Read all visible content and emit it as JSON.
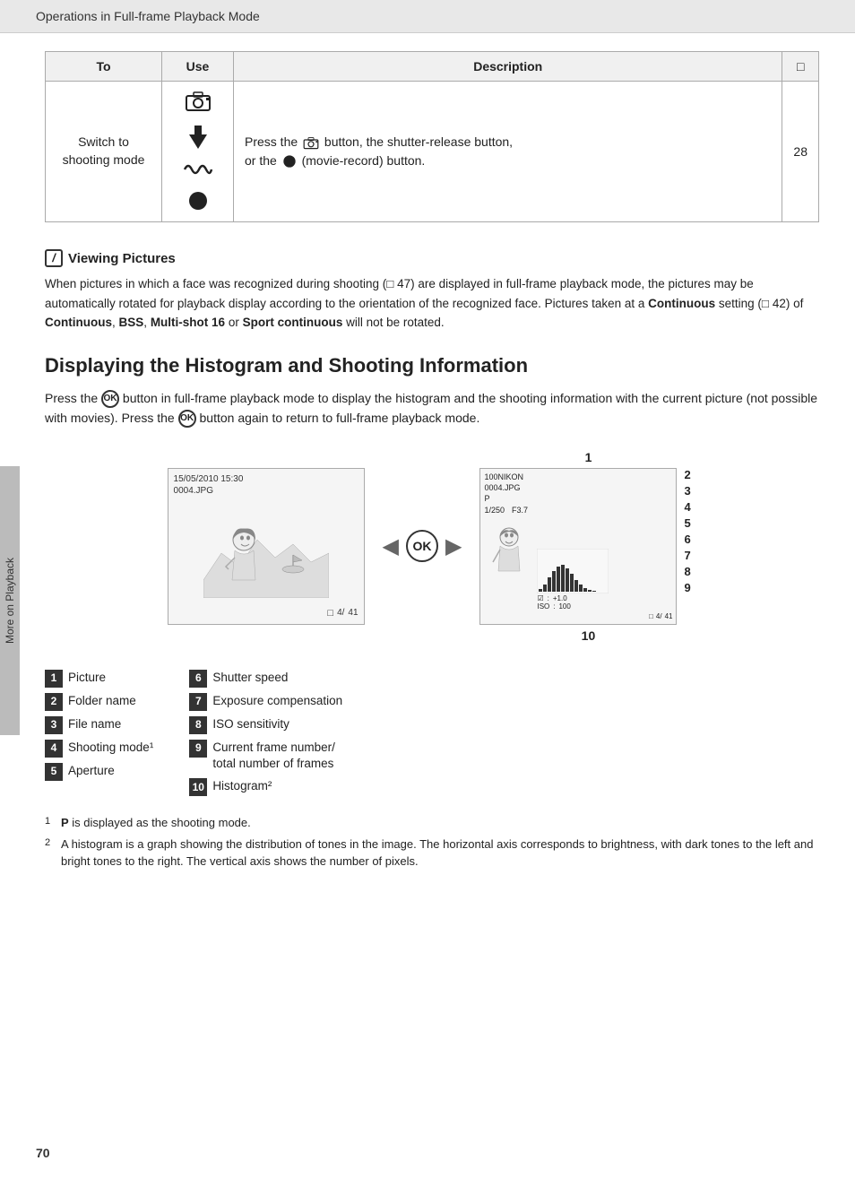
{
  "header": {
    "title": "Operations in Full-frame Playback Mode"
  },
  "table": {
    "headers": [
      "To",
      "Use",
      "Description",
      "□"
    ],
    "row": {
      "to_line1": "Switch to",
      "to_line2": "shooting mode",
      "description": "Press the",
      "description_mid": "button, the shutter-release button,",
      "description_end": "or the",
      "description_end2": "(movie-record) button.",
      "page_ref": "28"
    }
  },
  "note": {
    "title": "Viewing Pictures",
    "text": "When pictures in which a face was recognized during shooting (□ 47) are displayed in full-frame playback mode, the pictures may be automatically rotated for playback display according to the orientation of the recognized face. Pictures taken at a",
    "bold1": "Continuous",
    "text2": "setting (□ 42) of",
    "bold2": "Continuous",
    "text3": ",",
    "bold3": "BSS",
    "text4": ",",
    "bold4": "Multi-shot 16",
    "text5": "or",
    "bold5": "Sport continuous",
    "text6": "will not be rotated."
  },
  "section": {
    "heading": "Displaying the Histogram and Shooting Information",
    "intro_part1": "Press the",
    "intro_ok": "OK",
    "intro_part2": "button in full-frame playback mode to display the histogram and the shooting information with the current picture (not possible with movies). Press the",
    "intro_ok2": "OK",
    "intro_part3": "button again to return to full-frame playback mode."
  },
  "left_image": {
    "timestamp": "15/05/2010 15:30",
    "filename": "0004.JPG",
    "footer_left": "4/",
    "footer_right": "41"
  },
  "right_image": {
    "folder": "100NIKON",
    "filename": "0004.JPG",
    "mode": "P",
    "shutter": "1/250",
    "aperture": "F3.7",
    "ev_label": "☑",
    "ev_value": "+1.0",
    "iso_label": "ISO",
    "iso_value": "100",
    "frame_left": "4/",
    "frame_right": "41"
  },
  "labels": {
    "top": "1",
    "bottom": "10"
  },
  "right_numbers": [
    "2",
    "3",
    "4",
    "5",
    "6",
    "7",
    "8",
    "9"
  ],
  "legend": {
    "left_col": [
      {
        "num": "1",
        "text": "Picture"
      },
      {
        "num": "2",
        "text": "Folder name"
      },
      {
        "num": "3",
        "text": "File name"
      },
      {
        "num": "4",
        "text": "Shooting mode¹"
      },
      {
        "num": "5",
        "text": "Aperture"
      }
    ],
    "right_col": [
      {
        "num": "6",
        "text": "Shutter speed"
      },
      {
        "num": "7",
        "text": "Exposure compensation"
      },
      {
        "num": "8",
        "text": "ISO sensitivity"
      },
      {
        "num": "9",
        "text": "Current frame number/\ntotal number of frames"
      },
      {
        "num": "10",
        "text": "Histogram²"
      }
    ]
  },
  "footnotes": [
    {
      "sup": "1",
      "bold": "P",
      "text": "is displayed as the shooting mode."
    },
    {
      "sup": "2",
      "text": "A histogram is a graph showing the distribution of tones in the image. The horizontal axis corresponds to brightness, with dark tones to the left and bright tones to the right. The vertical axis shows the number of pixels."
    }
  ],
  "page_number": "70",
  "side_tab": "More on Playback"
}
